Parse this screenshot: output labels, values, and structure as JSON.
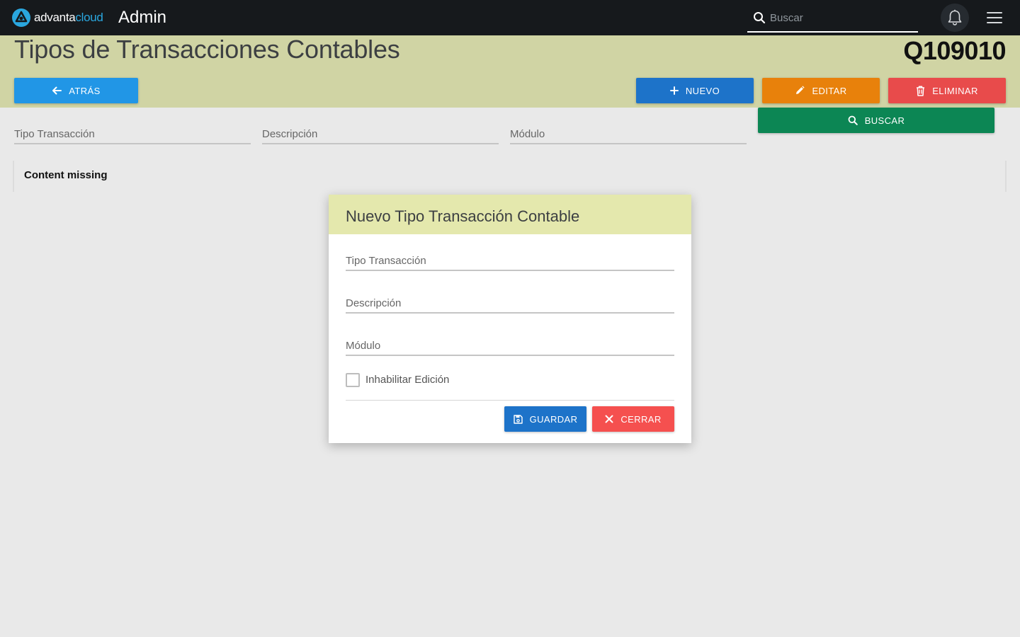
{
  "topbar": {
    "brand_part1": "advanta",
    "brand_part2": "cloud",
    "app_title": "Admin",
    "search_placeholder": "Buscar",
    "search_icon": "search-icon",
    "notification_icon": "bell-icon",
    "menu_icon": "hamburger-menu-icon"
  },
  "header": {
    "title": "Tipos de Transacciones Contables",
    "code": "Q109010",
    "background_color": "#d0d4a4"
  },
  "actions": {
    "back_label": "ATRÁS",
    "new_label": "NUEVO",
    "edit_label": "EDITAR",
    "delete_label": "ELIMINAR",
    "search_label": "BUSCAR",
    "colors": {
      "back": "#2196e6",
      "new": "#1d73c9",
      "edit": "#e8810b",
      "delete": "#e84b4b",
      "search": "#0c8654"
    }
  },
  "filters": {
    "fields": [
      "Tipo Transacción",
      "Descripción",
      "Módulo"
    ]
  },
  "content": {
    "message": "Content missing"
  },
  "modal": {
    "title": "Nuevo Tipo Transacción Contable",
    "fields": [
      "Tipo Transacción",
      "Descripción",
      "Módulo"
    ],
    "checkbox_label": "Inhabilitar Edición",
    "checkbox_checked": false,
    "save_label": "GUARDAR",
    "close_label": "CERRAR",
    "header_color": "#e4e8ad"
  }
}
